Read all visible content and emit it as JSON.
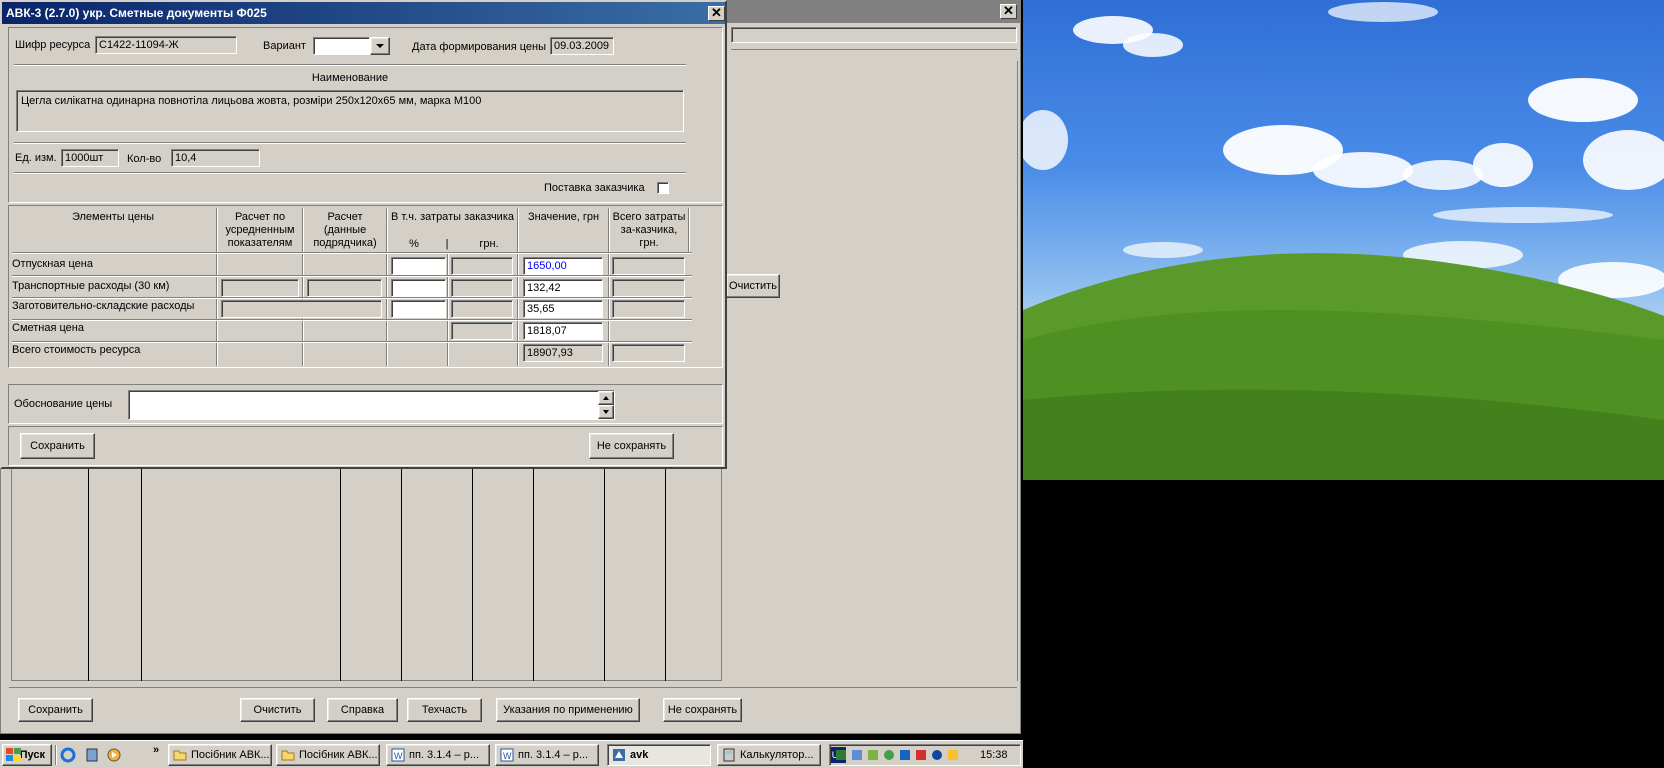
{
  "dialog": {
    "title": "АВК-3 (2.7.0)  укр.  Сметные документы        Ф025",
    "resource_code_label": "Шифр ресурса",
    "resource_code": "С1422-11094-Ж",
    "variant_label": "Вариант",
    "variant_value": "",
    "price_date_label": "Дата формирования цены",
    "price_date": "09.03.2009",
    "name_header": "Наименование",
    "name_text": "Цегла силікатна одинарна повнотіла лицьова жовта, розміри 250х120х65 мм, марка М100",
    "unit_label": "Ед. изм.",
    "unit_value": "1000шт",
    "qty_label": "Кол-во",
    "qty_value": "10,4",
    "customer_supply_label": "Поставка заказчика",
    "customer_supply_checked": false,
    "table": {
      "headers": {
        "elements": "Элементы цены",
        "avg": "Расчет по усредненным показателям",
        "contractor": "Расчет (данные подрядчика)",
        "incl_customer": "В т.ч. затраты заказчика",
        "pct": "%",
        "sep": "|",
        "grn": "грн.",
        "value": "Значение, грн",
        "total_customer": "Всего затраты за-казчика, грн."
      },
      "rows": [
        {
          "label": "Отпускная цена",
          "value": "1650,00"
        },
        {
          "label": "Транспортные расходы (30 км)",
          "value": "132,42"
        },
        {
          "label": "Заготовительно-складские расходы",
          "value": "35,65"
        },
        {
          "label": "Сметная цена",
          "value": "1818,07"
        },
        {
          "label": "Всего стоимость ресурса",
          "value": "18907,93"
        }
      ]
    },
    "clear_label": "Очистить",
    "justification_label": "Обоснование цены",
    "justification_value": "",
    "save_label": "Сохранить",
    "nosave_label": "Не сохранять",
    "close_glyph": "✕"
  },
  "back_window": {
    "close_glyph": "✕",
    "buttons": [
      "Сохранить",
      "Очистить",
      "Справка",
      "Техчасть",
      "Указания по применению",
      "Не сохранять"
    ]
  },
  "taskbar": {
    "start_label": "Пуск",
    "more_glyph": "»",
    "buttons": [
      {
        "label": "Посібник АВК...",
        "icon": "folder-icon"
      },
      {
        "label": "Посібник АВК...",
        "icon": "folder-icon"
      },
      {
        "label": "пп. 3.1.4 – р...",
        "icon": "word-icon"
      },
      {
        "label": "пп. 3.1.4 – р...",
        "icon": "word-icon"
      },
      {
        "label": "avk",
        "icon": "app-icon"
      },
      {
        "label": "Калькулятор...",
        "icon": "calculator-icon"
      }
    ],
    "lang": "UK",
    "clock": "15:38"
  },
  "colors": {
    "window_bg": "#d4d0c8",
    "title_bar": "#0a246a",
    "highlight_value": "#0000ff"
  }
}
